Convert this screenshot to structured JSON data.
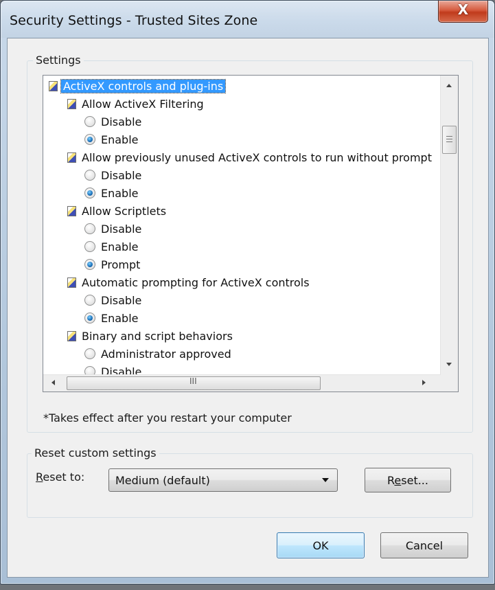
{
  "window": {
    "title": "Security Settings - Trusted Sites Zone",
    "close_label": "X"
  },
  "settings": {
    "group_label": "Settings",
    "note": "*Takes effect after you restart your computer",
    "tree": [
      {
        "kind": "category",
        "level": 0,
        "label": "ActiveX controls and plug-ins",
        "selected": true
      },
      {
        "kind": "setting",
        "level": 1,
        "label": "Allow ActiveX Filtering"
      },
      {
        "kind": "option",
        "level": 2,
        "label": "Disable",
        "checked": false
      },
      {
        "kind": "option",
        "level": 2,
        "label": "Enable",
        "checked": true
      },
      {
        "kind": "setting",
        "level": 1,
        "label": "Allow previously unused ActiveX controls to run without prompt"
      },
      {
        "kind": "option",
        "level": 2,
        "label": "Disable",
        "checked": false
      },
      {
        "kind": "option",
        "level": 2,
        "label": "Enable",
        "checked": true
      },
      {
        "kind": "setting",
        "level": 1,
        "label": "Allow Scriptlets"
      },
      {
        "kind": "option",
        "level": 2,
        "label": "Disable",
        "checked": false
      },
      {
        "kind": "option",
        "level": 2,
        "label": "Enable",
        "checked": false
      },
      {
        "kind": "option",
        "level": 2,
        "label": "Prompt",
        "checked": true
      },
      {
        "kind": "setting",
        "level": 1,
        "label": "Automatic prompting for ActiveX controls"
      },
      {
        "kind": "option",
        "level": 2,
        "label": "Disable",
        "checked": false
      },
      {
        "kind": "option",
        "level": 2,
        "label": "Enable",
        "checked": true
      },
      {
        "kind": "setting",
        "level": 1,
        "label": "Binary and script behaviors"
      },
      {
        "kind": "option",
        "level": 2,
        "label": "Administrator approved",
        "checked": false
      },
      {
        "kind": "option",
        "level": 2,
        "label": "Disable",
        "checked": false
      }
    ],
    "hscroll_grip": "III"
  },
  "reset": {
    "group_label": "Reset custom settings",
    "reset_to_prefix": "R",
    "reset_to_rest": "eset to:",
    "selected_level": "Medium (default)",
    "reset_button_prefix": "R",
    "reset_button_mnemonic": "e",
    "reset_button_rest": "set..."
  },
  "buttons": {
    "ok": "OK",
    "cancel": "Cancel"
  },
  "colors": {
    "selection": "#3399ff",
    "close_button": "#c8431f",
    "radio_checked": "#1a6fb8"
  }
}
